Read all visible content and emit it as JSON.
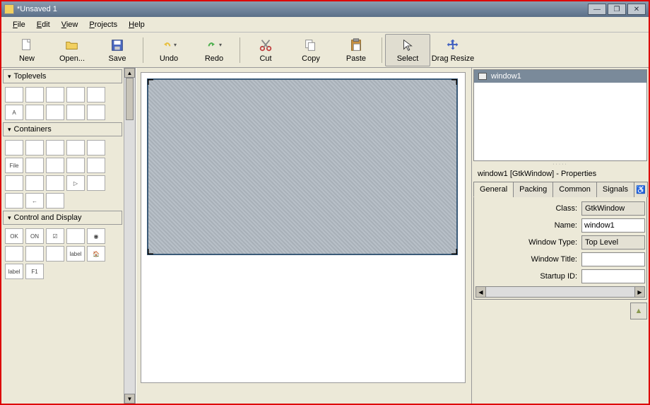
{
  "window": {
    "title": "*Unsaved 1"
  },
  "winbtns": {
    "min": "—",
    "max": "❐",
    "close": "✕"
  },
  "menu": {
    "file": "File",
    "edit": "Edit",
    "view": "View",
    "projects": "Projects",
    "help": "Help"
  },
  "toolbar": {
    "new": "New",
    "open": "Open...",
    "save": "Save",
    "undo": "Undo",
    "redo": "Redo",
    "cut": "Cut",
    "copy": "Copy",
    "paste": "Paste",
    "select": "Select",
    "drag_resize": "Drag Resize"
  },
  "palette": {
    "toplevels": "Toplevels",
    "containers": "Containers",
    "control_display": "Control and Display",
    "items_toplevels": [
      "",
      "",
      "",
      "",
      "",
      "A",
      "",
      "",
      "",
      ""
    ],
    "items_containers": [
      "",
      "",
      "",
      "",
      "",
      "File",
      "",
      "",
      "",
      "",
      "",
      "",
      "",
      "▷",
      "",
      "",
      "←",
      ""
    ],
    "items_control": [
      "OK",
      "ON",
      "☑",
      "",
      "◉",
      "",
      "",
      "",
      "label",
      "🏠",
      "label",
      "F1"
    ]
  },
  "tree": {
    "item0": "window1"
  },
  "props": {
    "title": "window1 [GtkWindow] - Properties",
    "tabs": {
      "general": "General",
      "packing": "Packing",
      "common": "Common",
      "signals": "Signals"
    },
    "rows": {
      "class_lbl": "Class:",
      "class_val": "GtkWindow",
      "name_lbl": "Name:",
      "name_val": "window1",
      "wtype_lbl": "Window Type:",
      "wtype_val": "Top Level",
      "wtitle_lbl": "Window Title:",
      "wtitle_val": "",
      "sid_lbl": "Startup ID:",
      "sid_val": ""
    }
  }
}
